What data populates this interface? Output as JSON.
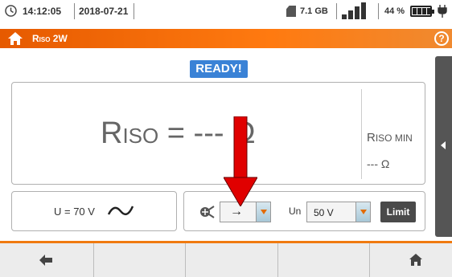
{
  "status": {
    "time": "14:12:05",
    "date": "2018-07-21",
    "storage": "7.1 GB",
    "battery": "44 %",
    "battery_level": 0.44
  },
  "title": {
    "main": "R",
    "sub": "ISO",
    "suffix": " 2W"
  },
  "ready_badge": "READY!",
  "result": {
    "symbol": "R",
    "symbol_sub": "ISO",
    "value": " = --- Ω",
    "min_label": "R",
    "min_label_sub": "ISO MIN",
    "min_value": "--- Ω"
  },
  "voltage": "U = 70 V",
  "controls": {
    "mode_value": "→",
    "un_label": "Un",
    "un_value": "50 V",
    "limit_label": "Limit"
  },
  "icons": {
    "clock": "clock-icon",
    "sd": "sd-card-icon",
    "signal": "signal-icon",
    "battery": "battery-icon",
    "plug": "plug-icon",
    "home": "home-icon",
    "help": "help-icon",
    "wave": "sine-wave-icon",
    "probe": "probe-icon",
    "back": "back-arrow-icon"
  },
  "colors": {
    "accent": "#f07a10",
    "ready": "#3a82d6",
    "annotation": "#e00000"
  }
}
